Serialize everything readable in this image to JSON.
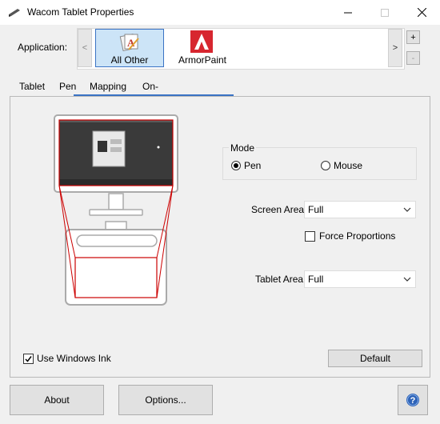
{
  "window": {
    "title": "Wacom Tablet Properties"
  },
  "application": {
    "label": "Application:",
    "prev_glyph": "<",
    "next_glyph": ">",
    "add_glyph": "+",
    "remove_glyph": "-",
    "apps": [
      {
        "label": "All Other",
        "icon": "all-other-icon",
        "selected": true
      },
      {
        "label": "ArmorPaint",
        "icon": "armorpaint-icon",
        "selected": false
      }
    ]
  },
  "tabs": [
    "Tablet",
    "Pen",
    "Mapping",
    "On-Screen Controls"
  ],
  "active_tab": "Mapping",
  "mapping": {
    "mode": {
      "title": "Mode",
      "options": [
        "Pen",
        "Mouse"
      ],
      "selected": "Pen"
    },
    "screen_area": {
      "label": "Screen Area:",
      "value": "Full"
    },
    "force_proportions": {
      "label": "Force Proportions",
      "checked": false
    },
    "tablet_area": {
      "label": "Tablet Area:",
      "value": "Full"
    },
    "use_windows_ink": {
      "label": "Use Windows Ink",
      "checked": true
    },
    "default_button": "Default"
  },
  "footer": {
    "about": "About",
    "options": "Options...",
    "help_icon": "help-icon"
  },
  "colors": {
    "accent": "#3a73c4",
    "mapping_outline": "#cc0000",
    "armorpaint_red": "#d7262f"
  }
}
